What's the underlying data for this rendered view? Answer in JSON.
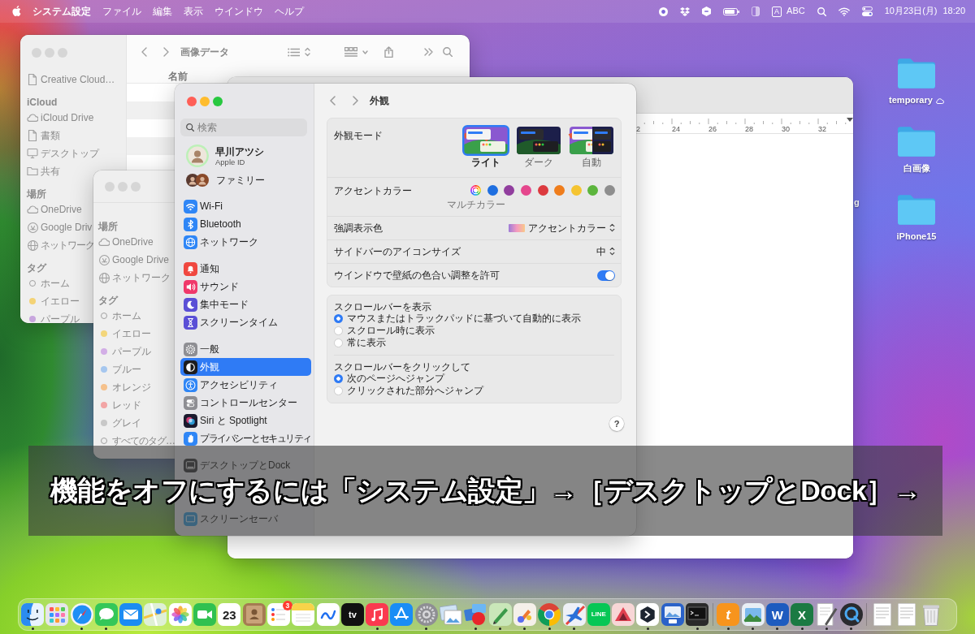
{
  "menu_bar": {
    "app_name": "システム設定",
    "menus": [
      "ファイル",
      "編集",
      "表示",
      "ウインドウ",
      "ヘルプ"
    ],
    "input_mode": "A",
    "input_source": "ABC",
    "date": "10月23日(月)",
    "time": "18:20"
  },
  "desktop": {
    "items": [
      {
        "label": "temporary",
        "cloud": true
      },
      {
        "label": "白画像",
        "cloud": false
      },
      {
        "label": "iPhone15",
        "cloud": false
      }
    ],
    "cut_label": "g"
  },
  "finder_back": {
    "title": "画像データ",
    "sidebar": [
      {
        "items": [
          {
            "label": "Creative Cloud…",
            "kind": "document"
          }
        ]
      },
      {
        "header": "iCloud",
        "items": [
          {
            "label": "iCloud Drive",
            "kind": "cloud"
          },
          {
            "label": "書類",
            "kind": "document"
          },
          {
            "label": "デスクトップ",
            "kind": "desktop"
          },
          {
            "label": "共有",
            "kind": "shared"
          }
        ]
      },
      {
        "header": "場所",
        "items": [
          {
            "label": "OneDrive",
            "kind": "cloud"
          },
          {
            "label": "Google Driv",
            "kind": "drive"
          },
          {
            "label": "ネットワーク",
            "kind": "network"
          }
        ]
      },
      {
        "header": "タグ",
        "items": [
          {
            "label": "ホーム",
            "kind": "tag"
          },
          {
            "label": "イエロー",
            "kind": "tag",
            "color": "#f4d376"
          },
          {
            "label": "パープル",
            "kind": "tag",
            "color": "#c8a6de"
          }
        ]
      }
    ],
    "columns": [
      "名前"
    ]
  },
  "document_window": {
    "ruler": [
      "2",
      "24",
      "26",
      "28",
      "30",
      "32"
    ]
  },
  "finder_front": {
    "sidebar": [
      {
        "header": "場所",
        "items": [
          {
            "label": "OneDrive",
            "kind": "cloud"
          },
          {
            "label": "Google Drive",
            "kind": "drive"
          },
          {
            "label": "ネットワーク",
            "kind": "network"
          }
        ]
      },
      {
        "header": "タグ",
        "items": [
          {
            "label": "ホーム",
            "kind": "tag"
          },
          {
            "label": "イエロー",
            "kind": "tag",
            "color": "#f3d67b"
          },
          {
            "label": "パープル",
            "kind": "tag",
            "color": "#d2aee6"
          },
          {
            "label": "ブルー",
            "kind": "tag",
            "color": "#a6c7ef"
          },
          {
            "label": "オレンジ",
            "kind": "tag",
            "color": "#f5c18c"
          },
          {
            "label": "レッド",
            "kind": "tag",
            "color": "#f2a5a5"
          },
          {
            "label": "グレイ",
            "kind": "tag",
            "color": "#c8c8c8"
          },
          {
            "label": "すべてのタグ…",
            "kind": "tag"
          }
        ]
      }
    ]
  },
  "settings": {
    "sidebar": {
      "search_placeholder": "検索",
      "account": {
        "name": "早川アツシ",
        "subtitle": "Apple ID"
      },
      "family": "ファミリー",
      "groups": [
        [
          {
            "label": "Wi-Fi",
            "kind": "wifi",
            "selected": false
          },
          {
            "label": "Bluetooth",
            "kind": "bluetooth",
            "selected": false
          },
          {
            "label": "ネットワーク",
            "kind": "network",
            "selected": false
          }
        ],
        [
          {
            "label": "通知",
            "kind": "notifications",
            "selected": false
          },
          {
            "label": "サウンド",
            "kind": "sound",
            "selected": false
          },
          {
            "label": "集中モード",
            "kind": "focus",
            "selected": false
          },
          {
            "label": "スクリーンタイム",
            "kind": "screentime",
            "selected": false
          }
        ],
        [
          {
            "label": "一般",
            "kind": "general",
            "selected": false
          },
          {
            "label": "外観",
            "kind": "appearance",
            "selected": true
          },
          {
            "label": "アクセシビリティ",
            "kind": "accessibility",
            "selected": false
          },
          {
            "label": "コントロールセンター",
            "kind": "controlcenter",
            "selected": false
          },
          {
            "label": "Siri と Spotlight",
            "kind": "siri",
            "selected": false
          },
          {
            "label": "プライバシーとセキュリティ",
            "kind": "privacy",
            "selected": false
          }
        ],
        [
          {
            "label": "デスクトップとDock",
            "kind": "dock",
            "selected": false
          },
          {
            "label": "スクリーンセーバ",
            "kind": "screensaver",
            "selected": false
          }
        ]
      ]
    },
    "pane": {
      "title": "外観",
      "rows": [
        {
          "kind": "mode",
          "label": "外観モード",
          "options": [
            {
              "label": "ライト",
              "kind": "light",
              "selected": true
            },
            {
              "label": "ダーク",
              "kind": "dark",
              "selected": false
            },
            {
              "label": "自動",
              "kind": "auto",
              "selected": false
            }
          ]
        },
        {
          "kind": "accent",
          "label": "アクセントカラー",
          "caption": "マルチカラー",
          "swatches": [
            {
              "kind": "multicolor",
              "selected": true
            },
            {
              "kind": "solid",
              "color": "#1f6fe0",
              "selected": false
            },
            {
              "kind": "solid",
              "color": "#913e9e",
              "selected": false
            },
            {
              "kind": "solid",
              "color": "#e5478d",
              "selected": false
            },
            {
              "kind": "solid",
              "color": "#dc3a3f",
              "selected": false
            },
            {
              "kind": "solid",
              "color": "#ef7d1c",
              "selected": false
            },
            {
              "kind": "solid",
              "color": "#f5c431",
              "selected": false
            },
            {
              "kind": "solid",
              "color": "#5cb53d",
              "selected": false
            },
            {
              "kind": "solid",
              "color": "#8e8e8e",
              "selected": false
            }
          ]
        },
        {
          "kind": "popup",
          "label": "強調表示色",
          "value": "アクセントカラー",
          "swatch": true
        },
        {
          "kind": "popup",
          "label": "サイドバーのアイコンサイズ",
          "value": "中"
        },
        {
          "kind": "toggle",
          "label": "ウインドウで壁紙の色合い調整を許可",
          "on": true
        }
      ],
      "radio_groups": [
        {
          "label": "スクロールバーを表示",
          "options": [
            {
              "label": "マウスまたはトラックパッドに基づいて自動的に表示",
              "selected": true
            },
            {
              "label": "スクロール時に表示",
              "selected": false
            },
            {
              "label": "常に表示",
              "selected": false
            }
          ]
        },
        {
          "label": "スクロールバーをクリックして",
          "options": [
            {
              "label": "次のページへジャンプ",
              "selected": true
            },
            {
              "label": "クリックされた部分へジャンプ",
              "selected": false
            }
          ]
        }
      ],
      "help": "?"
    }
  },
  "caption": {
    "text": "機能をオフにするには「システム設定」→［デスクトップとDock］→"
  },
  "dock": {
    "sections": [
      [
        {
          "kind": "finder",
          "running": true
        },
        {
          "kind": "launchpad",
          "running": false
        },
        {
          "kind": "safari",
          "running": true
        },
        {
          "kind": "messages",
          "running": true
        },
        {
          "kind": "mail",
          "running": false
        },
        {
          "kind": "maps",
          "running": false
        },
        {
          "kind": "photos",
          "running": false
        },
        {
          "kind": "facetime",
          "running": false
        },
        {
          "kind": "calendar",
          "label": "23",
          "running": false
        },
        {
          "kind": "contacts",
          "running": false
        },
        {
          "kind": "reminders",
          "badge": "3",
          "running": false
        },
        {
          "kind": "notes",
          "running": false
        },
        {
          "kind": "freeform",
          "running": false
        },
        {
          "kind": "tv",
          "label": "tv",
          "running": false
        },
        {
          "kind": "music",
          "running": true
        },
        {
          "kind": "appstore",
          "running": false
        },
        {
          "kind": "settings",
          "running": true
        },
        {
          "kind": "preview",
          "running": false
        },
        {
          "kind": "collage",
          "running": true
        },
        {
          "kind": "pen",
          "running": true
        },
        {
          "kind": "paint",
          "running": true
        },
        {
          "kind": "chrome",
          "running": true
        },
        {
          "kind": "airplane",
          "running": true
        },
        {
          "kind": "line",
          "label": "LINE",
          "running": false
        },
        {
          "kind": "triangle",
          "running": false
        },
        {
          "kind": "hexagon",
          "running": true
        },
        {
          "kind": "picture",
          "running": false
        },
        {
          "kind": "terminal",
          "running": true
        }
      ],
      [
        {
          "kind": "toolbox",
          "label": "t",
          "running": true
        },
        {
          "kind": "photo",
          "running": true
        },
        {
          "kind": "word",
          "label": "W",
          "running": true
        },
        {
          "kind": "excel",
          "label": "X",
          "running": true
        },
        {
          "kind": "textedit",
          "running": true
        },
        {
          "kind": "quicktime",
          "running": true
        }
      ],
      [
        {
          "kind": "document",
          "running": false
        },
        {
          "kind": "document",
          "running": false
        },
        {
          "kind": "trash",
          "running": false
        }
      ]
    ]
  }
}
